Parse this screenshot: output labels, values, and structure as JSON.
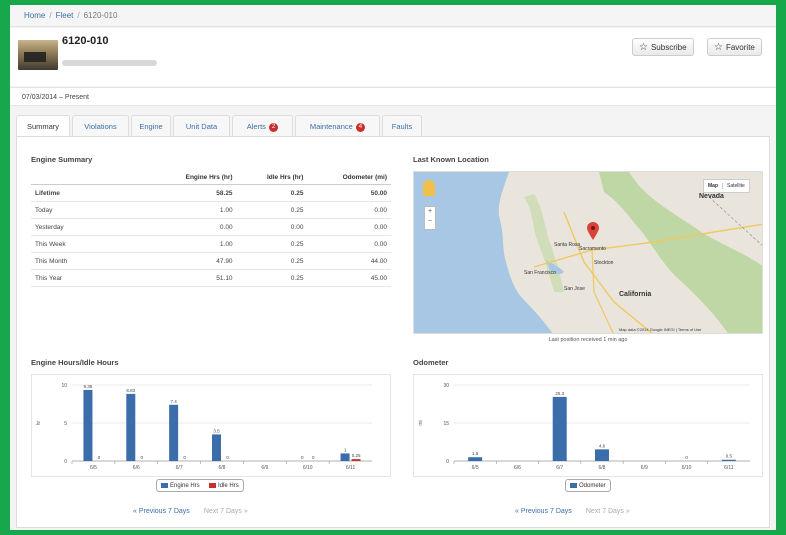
{
  "breadcrumb": {
    "home": "Home",
    "fleet": "Fleet",
    "current": "6120-010"
  },
  "unit": {
    "title": "6120-010"
  },
  "actions": {
    "subscribe": "Subscribe",
    "favorite": "Favorite"
  },
  "date_range": "07/03/2014 – Present",
  "tabs": [
    {
      "label": "Summary"
    },
    {
      "label": "Violations"
    },
    {
      "label": "Engine"
    },
    {
      "label": "Unit Data"
    },
    {
      "label": "Alerts",
      "badge": "2"
    },
    {
      "label": "Maintenance",
      "badge": "4"
    },
    {
      "label": "Faults"
    }
  ],
  "engine_summary": {
    "title": "Engine Summary",
    "columns": [
      "",
      "Engine Hrs (hr)",
      "Idle Hrs (hr)",
      "Odometer (mi)"
    ],
    "rows": [
      [
        "Lifetime",
        "58.25",
        "0.25",
        "50.00"
      ],
      [
        "Today",
        "1.00",
        "0.25",
        "0.00"
      ],
      [
        "Yesterday",
        "0.00",
        "0.00",
        "0.00"
      ],
      [
        "This Week",
        "1.00",
        "0.25",
        "0.00"
      ],
      [
        "This Month",
        "47.90",
        "0.25",
        "44.00"
      ],
      [
        "This Year",
        "51.10",
        "0.25",
        "45.00"
      ]
    ]
  },
  "location": {
    "title": "Last Known Location",
    "caption": "Last position received 1 min ago",
    "map_type_buttons": [
      "Map",
      "Satellite"
    ],
    "labels": [
      "Nevada",
      "California",
      "Sacramento",
      "San Francisco",
      "San Jose",
      "Stockton",
      "Santa Rosa",
      "Map data ©2014 Google INEGI | Terms of Use"
    ]
  },
  "chart_data": [
    {
      "type": "bar",
      "title": "Engine Hours/Idle Hours",
      "ylabel": "hr",
      "ylim": [
        0,
        10
      ],
      "yticks": [
        0,
        5,
        10
      ],
      "categories": [
        "6/5",
        "6/6",
        "6/7",
        "6/8",
        "6/9",
        "6/10",
        "6/11"
      ],
      "series": [
        {
          "name": "Engine Hrs",
          "color": "#3b6dab",
          "values": [
            9.35,
            8.83,
            7.4,
            3.5,
            0,
            0,
            1
          ],
          "labels": [
            "9.35",
            "8.83",
            "7.4",
            "3.5",
            "",
            "0",
            "1"
          ]
        },
        {
          "name": "Idle Hrs",
          "color": "#c9302c",
          "values": [
            0,
            0,
            0,
            0,
            0,
            0,
            0.25
          ],
          "labels": [
            "0",
            "0",
            "0",
            "0",
            "",
            "0",
            "0.25"
          ]
        }
      ]
    },
    {
      "type": "bar",
      "title": "Odometer",
      "ylabel": "mi",
      "ylim": [
        0,
        30
      ],
      "yticks": [
        0,
        15,
        30
      ],
      "categories": [
        "6/5",
        "6/6",
        "6/7",
        "6/8",
        "6/9",
        "6/10",
        "6/11"
      ],
      "series": [
        {
          "name": "Odometer",
          "color": "#3b6dab",
          "values": [
            1.5,
            0,
            25.3,
            4.6,
            0,
            0,
            0.5
          ],
          "labels": [
            "1.5",
            "",
            "25.3",
            "4.6",
            "",
            "0",
            "0.5"
          ]
        }
      ]
    }
  ],
  "pager": {
    "prev": "« Previous 7 Days",
    "next": "Next 7 Days »"
  }
}
